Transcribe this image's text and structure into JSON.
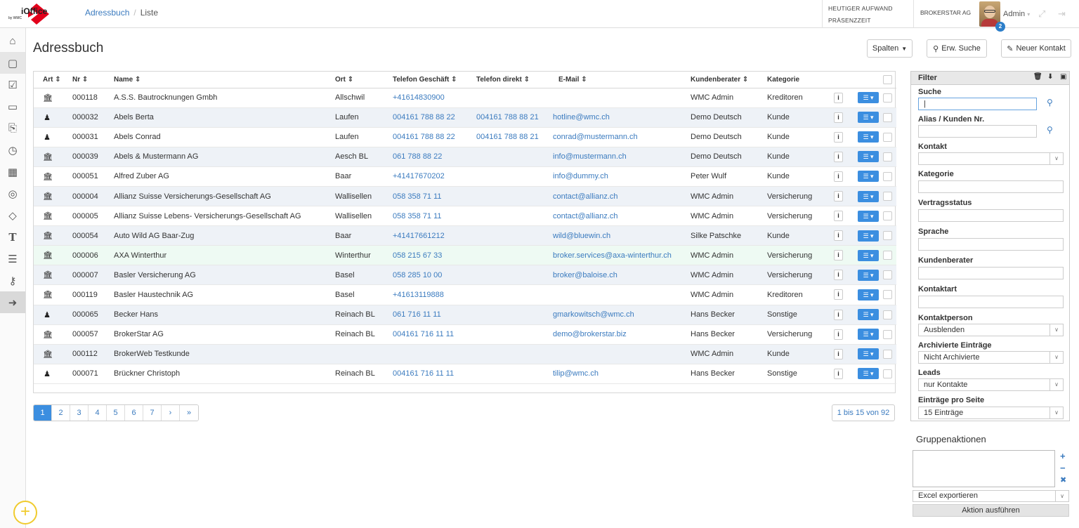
{
  "brand": {
    "logo_text": "iOffice",
    "logo_sub": "by WMC",
    "accent": "#e3001b"
  },
  "breadcrumb": {
    "root": "Adressbuch",
    "current": "Liste"
  },
  "topbar": {
    "aufwand": "HEUTIGER AUFWAND",
    "praesenz": "PRÄSENZZEIT",
    "company": "BROKERSTAR AG",
    "user": "Admin",
    "badge": "2"
  },
  "page": {
    "title": "Adressbuch"
  },
  "toolbar": {
    "columns": "Spalten",
    "search": "Erw. Suche",
    "new_contact": "Neuer Kontakt"
  },
  "table": {
    "headers": {
      "art": "Art",
      "nr": "Nr",
      "name": "Name",
      "ort": "Ort",
      "tel_business": "Telefon Geschäft",
      "tel_direct": "Telefon direkt",
      "email": "E-Mail",
      "advisor": "Kundenberater",
      "category": "Kategorie"
    },
    "rows": [
      {
        "type": "company",
        "nr": "000118",
        "name": "A.S.S. Bautrocknungen Gmbh",
        "ort": "Allschwil",
        "tel": "+41614830900",
        "direct": "",
        "email": "",
        "advisor": "WMC Admin",
        "category": "Kreditoren"
      },
      {
        "type": "person",
        "nr": "000032",
        "name": "Abels Berta",
        "ort": "Laufen",
        "tel": "004161 788 88 22",
        "direct": "004161 788 88 21",
        "email": "hotline@wmc.ch",
        "advisor": "Demo Deutsch",
        "category": "Kunde"
      },
      {
        "type": "person",
        "nr": "000031",
        "name": "Abels Conrad",
        "ort": "Laufen",
        "tel": "004161 788 88 22",
        "direct": "004161 788 88 21",
        "email": "conrad@mustermann.ch",
        "advisor": "Demo Deutsch",
        "category": "Kunde"
      },
      {
        "type": "company",
        "nr": "000039",
        "name": "Abels & Mustermann AG",
        "ort": "Aesch BL",
        "tel": "061 788 88 22",
        "direct": "",
        "email": "info@mustermann.ch",
        "advisor": "Demo Deutsch",
        "category": "Kunde"
      },
      {
        "type": "company",
        "nr": "000051",
        "name": "Alfred Zuber AG",
        "ort": "Baar",
        "tel": "+41417670202",
        "direct": "",
        "email": "info@dummy.ch",
        "advisor": "Peter Wulf",
        "category": "Kunde"
      },
      {
        "type": "company",
        "nr": "000004",
        "name": "Allianz Suisse Versicherungs-Gesellschaft AG",
        "ort": "Wallisellen",
        "tel": "058 358 71 11",
        "direct": "",
        "email": "contact@allianz.ch",
        "advisor": "WMC Admin",
        "category": "Versicherung"
      },
      {
        "type": "company",
        "nr": "000005",
        "name": "Allianz Suisse Lebens- Versicherungs-Gesellschaft AG",
        "ort": "Wallisellen",
        "tel": "058 358 71 11",
        "direct": "",
        "email": "contact@allianz.ch",
        "advisor": "WMC Admin",
        "category": "Versicherung"
      },
      {
        "type": "company",
        "nr": "000054",
        "name": "Auto Wild AG Baar-Zug",
        "ort": "Baar",
        "tel": "+41417661212",
        "direct": "",
        "email": "wild@bluewin.ch",
        "advisor": "Silke Patschke",
        "category": "Kunde"
      },
      {
        "type": "company",
        "nr": "000006",
        "name": "AXA Winterthur",
        "ort": "Winterthur",
        "tel": "058 215 67 33",
        "direct": "",
        "email": "broker.services@axa-winterthur.ch",
        "advisor": "WMC Admin",
        "category": "Versicherung",
        "highlight": true
      },
      {
        "type": "company",
        "nr": "000007",
        "name": "Basler Versicherung AG",
        "ort": "Basel",
        "tel": "058 285 10 00",
        "direct": "",
        "email": "broker@baloise.ch",
        "advisor": "WMC Admin",
        "category": "Versicherung"
      },
      {
        "type": "company",
        "nr": "000119",
        "name": "Basler Haustechnik AG",
        "ort": "Basel",
        "tel": "+41613119888",
        "direct": "",
        "email": "",
        "advisor": "WMC Admin",
        "category": "Kreditoren"
      },
      {
        "type": "person",
        "nr": "000065",
        "name": "Becker Hans",
        "ort": "Reinach BL",
        "tel": "061 716 11 11",
        "direct": "",
        "email": "gmarkowitsch@wmc.ch",
        "advisor": "Hans Becker",
        "category": "Sonstige"
      },
      {
        "type": "company",
        "nr": "000057",
        "name": "BrokerStar AG",
        "ort": "Reinach BL",
        "tel": "004161 716 11 11",
        "direct": "",
        "email": "demo@brokerstar.biz",
        "advisor": "Hans Becker",
        "category": "Versicherung"
      },
      {
        "type": "company",
        "nr": "000112",
        "name": "BrokerWeb Testkunde",
        "ort": "",
        "tel": "",
        "direct": "",
        "email": "",
        "advisor": "WMC Admin",
        "category": "Kunde"
      },
      {
        "type": "person",
        "nr": "000071",
        "name": "Brückner Christoph",
        "ort": "Reinach BL",
        "tel": "004161 716 11 11",
        "direct": "",
        "email": "tilip@wmc.ch",
        "advisor": "Hans Becker",
        "category": "Sonstige"
      }
    ]
  },
  "pagination": {
    "pages": [
      "1",
      "2",
      "3",
      "4",
      "5",
      "6",
      "7",
      "›",
      "»"
    ],
    "active": "1",
    "summary": "1 bis 15 von 92"
  },
  "filter": {
    "title": "Filter",
    "suche": "Suche",
    "alias": "Alias / Kunden Nr.",
    "kontakt": "Kontakt",
    "kategorie": "Kategorie",
    "vertragsstatus": "Vertragsstatus",
    "sprache": "Sprache",
    "kundenberater": "Kundenberater",
    "kontaktart": "Kontaktart",
    "kontaktperson": "Kontaktperson",
    "kontaktperson_value": "Ausblenden",
    "archiviert": "Archivierte Einträge",
    "archiviert_value": "Nicht Archivierte",
    "leads": "Leads",
    "leads_value": "nur Kontakte",
    "per_page": "Einträge pro Seite",
    "per_page_value": "15 Einträge"
  },
  "group": {
    "title": "Gruppenaktionen",
    "select_value": "Excel exportieren",
    "execute": "Aktion ausführen"
  }
}
